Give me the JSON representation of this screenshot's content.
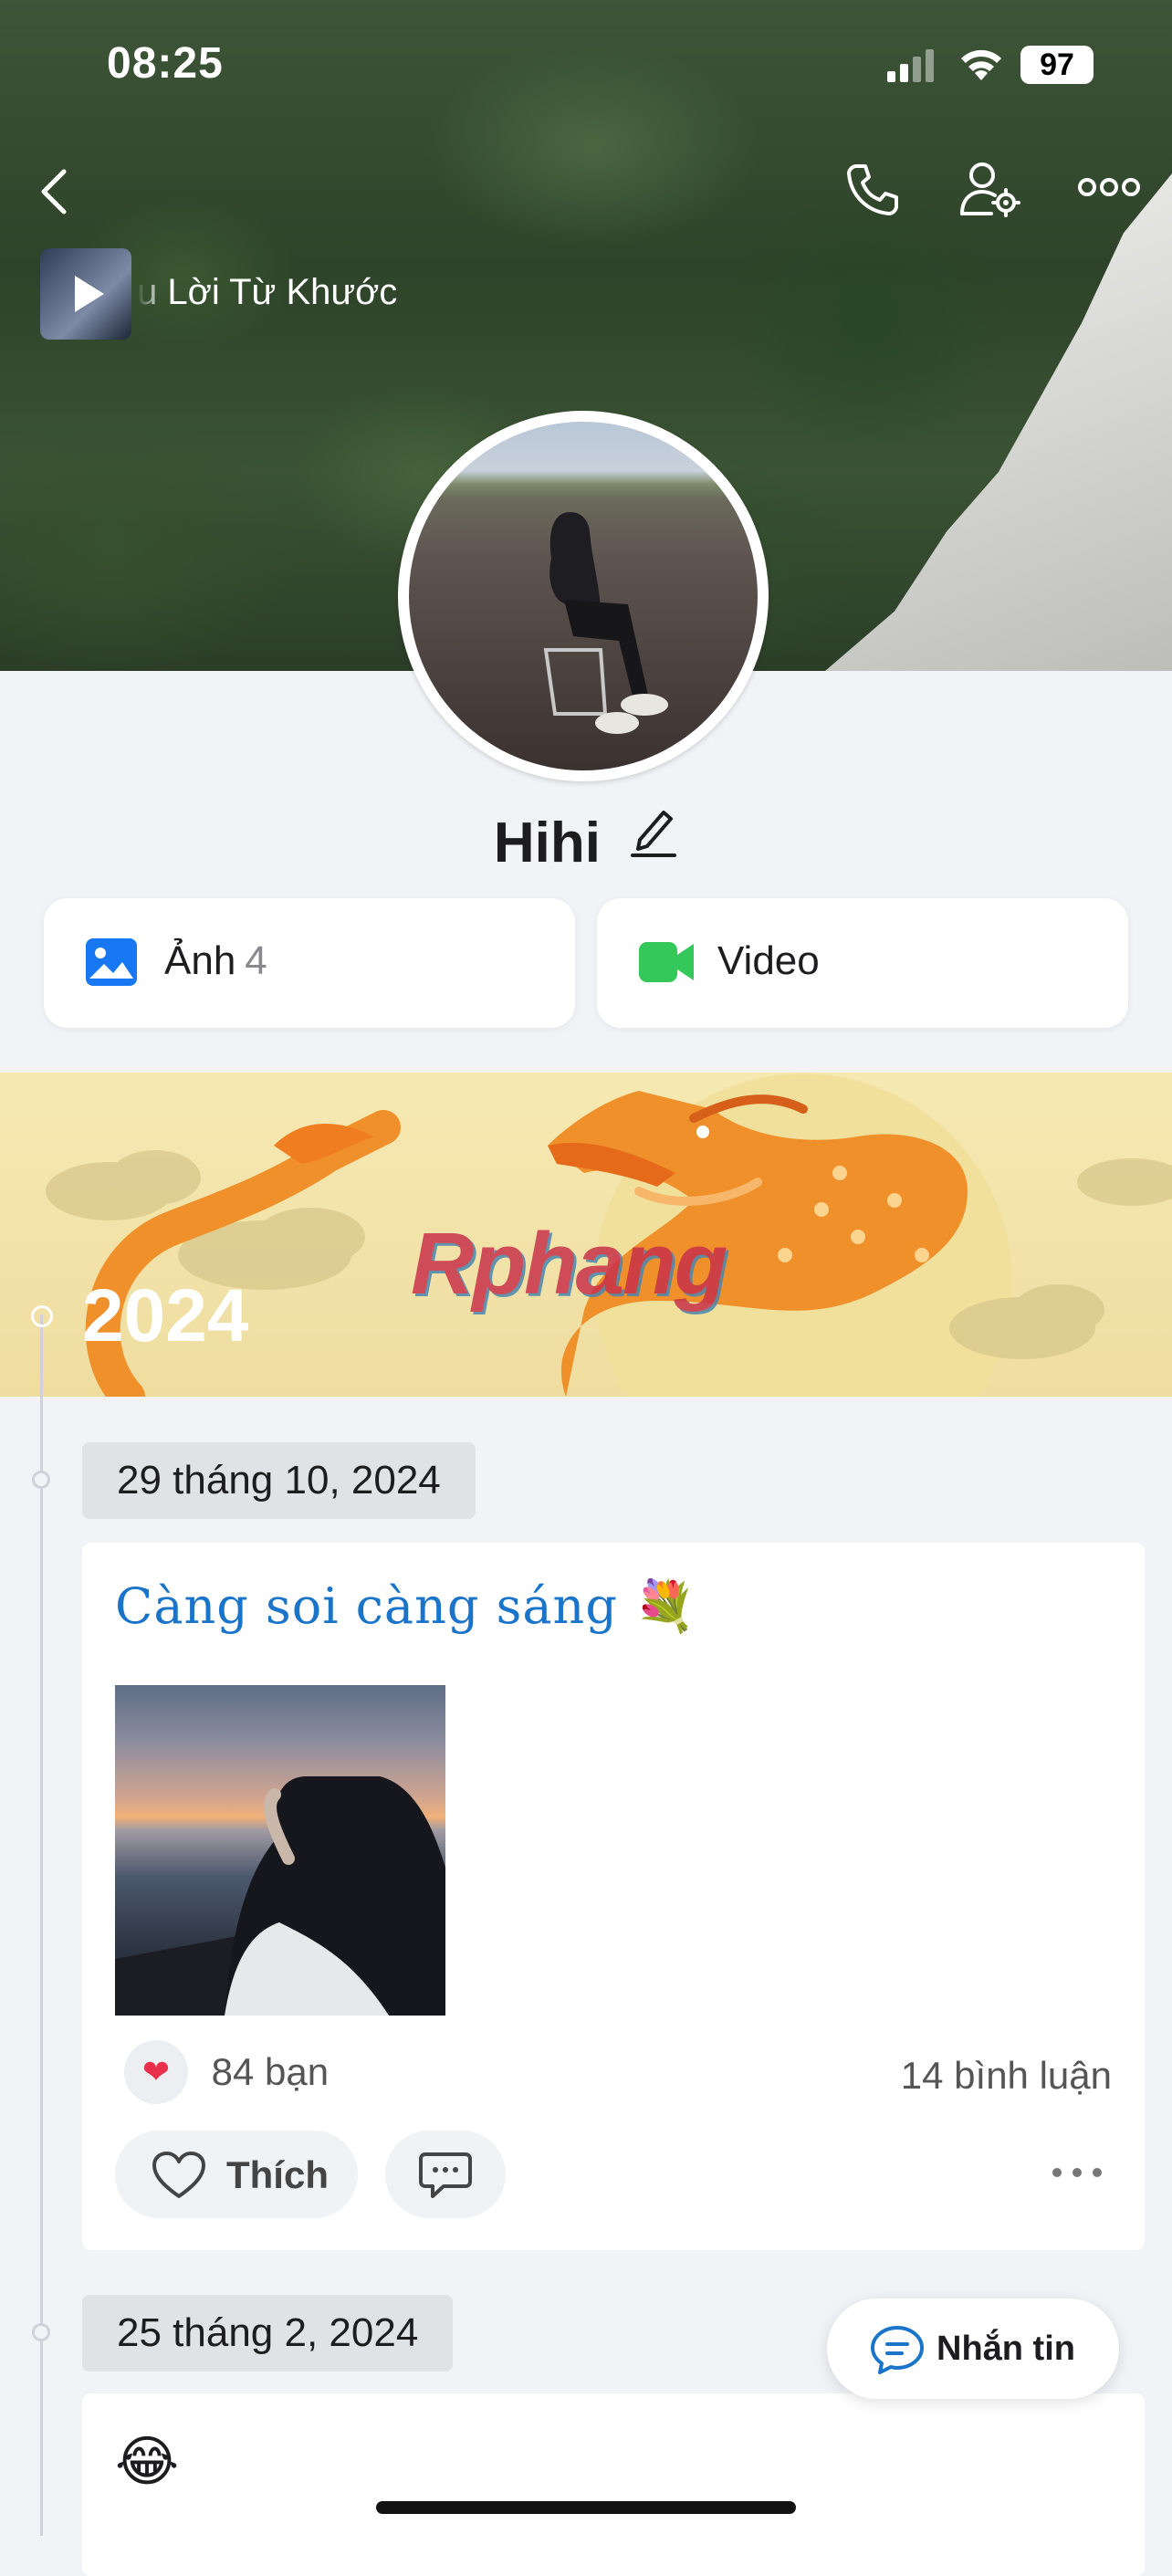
{
  "status_bar": {
    "time": "08:25",
    "battery": "97"
  },
  "header": {
    "icons": [
      "chevron-left-icon",
      "phone-icon",
      "user-settings-icon",
      "more-horizontal-icon"
    ]
  },
  "music": {
    "title": "u Lời Từ Khước"
  },
  "profile": {
    "name": "Hihi"
  },
  "media": {
    "photos_label": "Ảnh",
    "photos_count": "4",
    "video_label": "Video"
  },
  "timeline": {
    "year": "2024",
    "watermark": "Rphang",
    "posts": [
      {
        "date": "29 tháng 10, 2024",
        "title": "Càng soi càng sáng 💐",
        "reactions": "84 bạn",
        "comments": "14 bình luận",
        "like_label": "Thích"
      },
      {
        "date": "25 tháng 2, 2024",
        "emoji": "😂"
      }
    ]
  },
  "floating": {
    "message_label": "Nhắn tin"
  },
  "colors": {
    "accent": "#1a74c9",
    "photo_icon": "#1877f2",
    "video_icon": "#34c759",
    "heart": "#e8304a"
  }
}
